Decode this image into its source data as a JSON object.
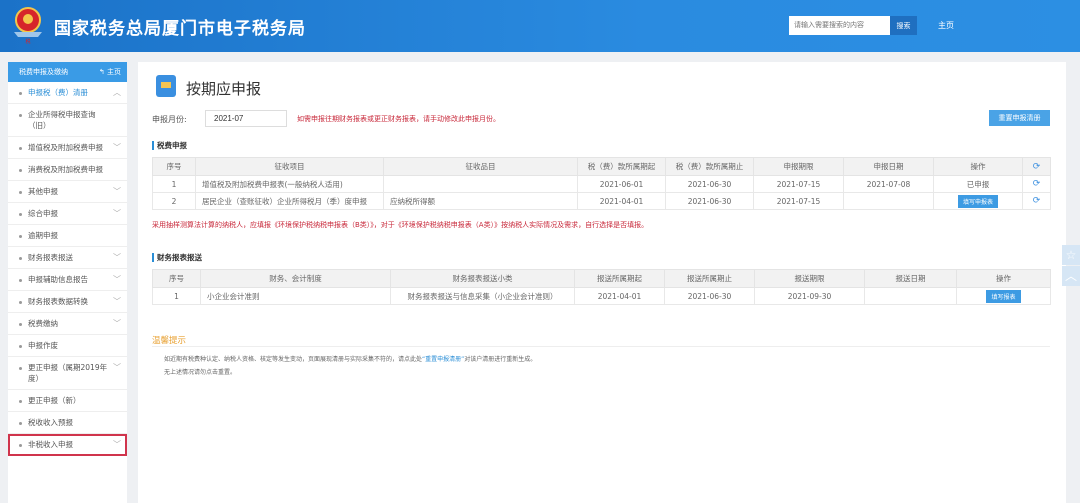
{
  "header": {
    "title": "国家税务总局厦门市电子税务局",
    "search_placeholder": "请输入需要搜索的内容",
    "search_button": "搜索",
    "home": "主页"
  },
  "sidebar": {
    "title": "税费申报及缴纳",
    "home": "主页",
    "items": [
      {
        "label": "申报税（费）清册",
        "chevron": "up",
        "active": true
      },
      {
        "label": "企业所得税申报查询（旧）"
      },
      {
        "label": "增值税及附加税费申报",
        "chevron": "down"
      },
      {
        "label": "消费税及附加税费申报"
      },
      {
        "label": "其他申报",
        "chevron": "down"
      },
      {
        "label": "综合申报",
        "chevron": "down"
      },
      {
        "label": "逾期申报"
      },
      {
        "label": "财务报表报送",
        "chevron": "down"
      },
      {
        "label": "申报辅助信息报告",
        "chevron": "down"
      },
      {
        "label": "财务报表数据转换",
        "chevron": "down"
      },
      {
        "label": "税费缴纳",
        "chevron": "down"
      },
      {
        "label": "申报作废"
      },
      {
        "label": "更正申报（属期2019年度）",
        "chevron": "down"
      },
      {
        "label": "更正申报（新）"
      },
      {
        "label": "税收收入预报"
      },
      {
        "label": "非税收入申报",
        "chevron": "down",
        "highlighted": true
      }
    ]
  },
  "main": {
    "title": "按期应申报",
    "month_label": "申报月份:",
    "month_value": "2021-07",
    "month_warning": "如需申报往期财务报表或更正财务报表，请手动修改此申报月份。",
    "reset_button": "重置申报清册",
    "tax_section": "税费申报",
    "tax_headers": [
      "序号",
      "征收项目",
      "征收品目",
      "税（费）款所属期起",
      "税（费）款所属期止",
      "申报期限",
      "申报日期",
      "操作"
    ],
    "tax_rows": [
      {
        "no": "1",
        "item": "增值税及附加税费申报表(一般纳税人适用)",
        "sub": "",
        "start": "2021-06-01",
        "end": "2021-06-30",
        "deadline": "2021-07-15",
        "date": "2021-07-08",
        "op": "已申报",
        "op_button": false
      },
      {
        "no": "2",
        "item": "居民企业（查账征收）企业所得税月（季）度申报",
        "sub": "应纳税所得额",
        "start": "2021-04-01",
        "end": "2021-06-30",
        "deadline": "2021-07-15",
        "date": "",
        "op": "填写申报表",
        "op_button": true
      }
    ],
    "env_warning": "采用抽样测算法计算的纳税人，应填报《环境保护税纳税申报表（B类）》，对于《环境保护税纳税申报表（A类）》按纳税人实际情况及需求，自行选择是否填报。",
    "fin_section": "财务报表报送",
    "fin_headers": [
      "序号",
      "财务、会计制度",
      "财务报表报送小类",
      "报送所属期起",
      "报送所属期止",
      "报送期限",
      "报送日期",
      "操作"
    ],
    "fin_rows": [
      {
        "no": "1",
        "system": "小企业会计准则",
        "category": "财务报表报送与信息采集（小企业会计准则）",
        "start": "2021-04-01",
        "end": "2021-06-30",
        "deadline": "2021-09-30",
        "date": "",
        "op": "填写报表"
      }
    ],
    "tips_title": "温馨提示",
    "tip1_a": "如近期有税费种认定、纳税人资格、核定等发生变动，页面展现清册与实际采集不符的，请点此处",
    "tip1_link": "“重置申报清册”",
    "tip1_b": "对该户清册进行重新生成。",
    "tip2": "无上述情况请勿点击重置。"
  }
}
